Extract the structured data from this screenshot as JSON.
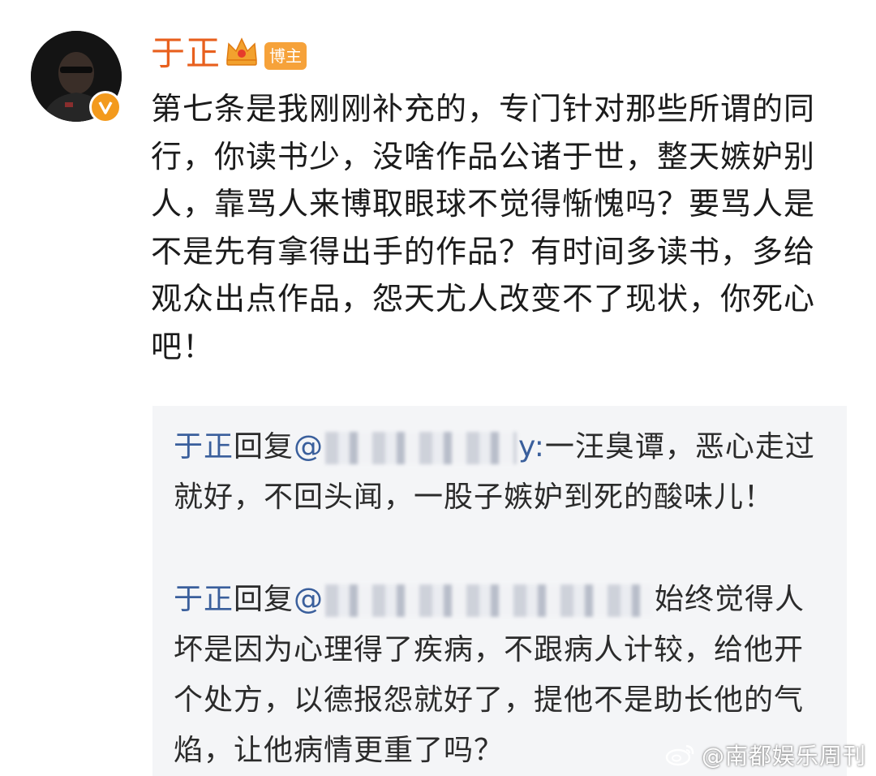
{
  "user": {
    "name": "于正",
    "role_badge": "博主"
  },
  "post": {
    "text": "第七条是我刚刚补充的，专门针对那些所谓的同行，你读书少，没啥作品公诸于世，整天嫉妒别人，靠骂人来博取眼球不觉得惭愧吗？要骂人是不是先有拿得出手的作品？有时间多读书，多给观众出点作品，怨天尤人改变不了现状，你死心吧！"
  },
  "replies": [
    {
      "author": "于正",
      "verb": "回复",
      "mention_prefix": "@",
      "mention_suffix": "y:",
      "text": "一汪臭谭，恶心走过就好，不回头闻，一股子嫉妒到死的酸味儿！"
    },
    {
      "author": "于正",
      "verb": "回复",
      "mention_prefix": "@",
      "mention_suffix": "",
      "text": "始终觉得人坏是因为心理得了疾病，不跟病人计较，给他开个处方，以德报怨就好了，提他不是助长他的气焰，让他病情更重了吗？"
    }
  ],
  "watermark": {
    "text": "@南都娱乐周刊"
  },
  "colors": {
    "username": "#e8601e",
    "badge_bg": "#f6a23a",
    "link": "#3a5f9c",
    "panel_bg": "#f4f5f7",
    "verified": "#f39a1d"
  },
  "icons": {
    "crown": "crown-icon",
    "verified": "verified-v-icon",
    "weibo": "weibo-logo-icon"
  }
}
